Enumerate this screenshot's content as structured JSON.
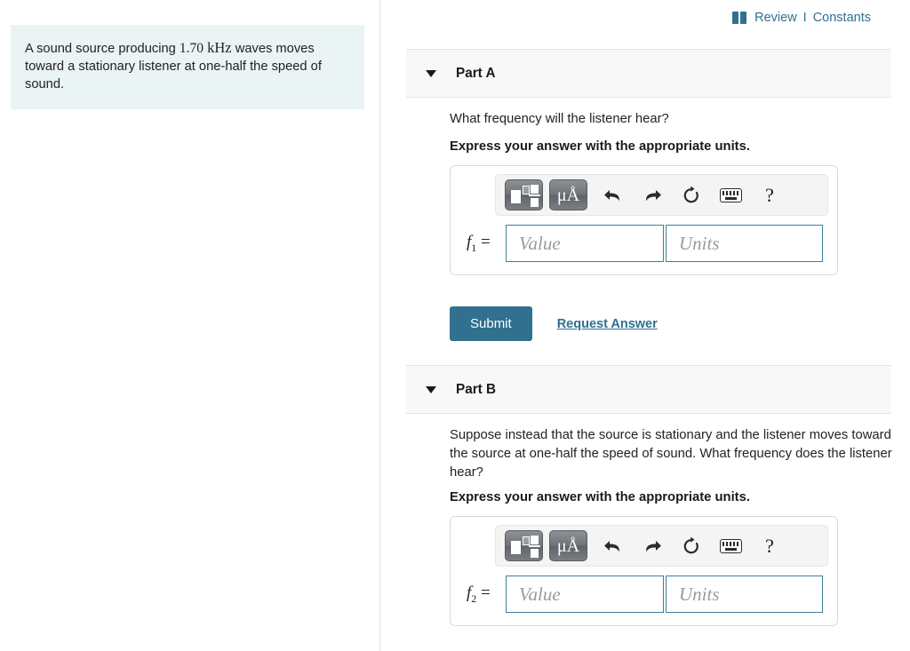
{
  "problem": {
    "text_before_number": "A sound source producing ",
    "number": "1.70",
    "unit": "kHz",
    "text_after_unit": " waves moves toward a stationary listener at one-half the speed of sound."
  },
  "header": {
    "book_icon": "book-icon",
    "review_label": "Review",
    "separator": "I",
    "constants_label": "Constants",
    "link_color": "#31708f"
  },
  "parts": [
    {
      "id": "part-a",
      "title": "Part A",
      "question": "What frequency will the listener hear?",
      "instruction": "Express your answer with the appropriate units.",
      "variable": "f",
      "subscript": "1",
      "equals": "=",
      "value_placeholder": "Value",
      "units_placeholder": "Units",
      "value_text": "",
      "units_text": "",
      "submit_label": "Submit",
      "request_answer_label": "Request Answer",
      "has_submit": true
    },
    {
      "id": "part-b",
      "title": "Part B",
      "question": "Suppose instead that the source is stationary and the listener moves toward the source at one-half the speed of sound. What frequency does the listener hear?",
      "instruction": "Express your answer with the appropriate units.",
      "variable": "f",
      "subscript": "2",
      "equals": "=",
      "value_placeholder": "Value",
      "units_placeholder": "Units",
      "value_text": "",
      "units_text": "",
      "has_submit": false
    }
  ],
  "toolbar": {
    "template_icon": "math-template-icon",
    "units_button_label": "μÅ",
    "undo_icon": "undo-arrow-icon",
    "redo_icon": "redo-arrow-icon",
    "reset_icon": "reset-circular-arrow-icon",
    "keyboard_icon": "keyboard-icon",
    "help_label": "?"
  },
  "colors": {
    "problem_box_bg": "#eaf4f4",
    "accent": "#31708f",
    "part_header_bg": "#f8f8f8",
    "field_border": "#3f7f9e"
  }
}
